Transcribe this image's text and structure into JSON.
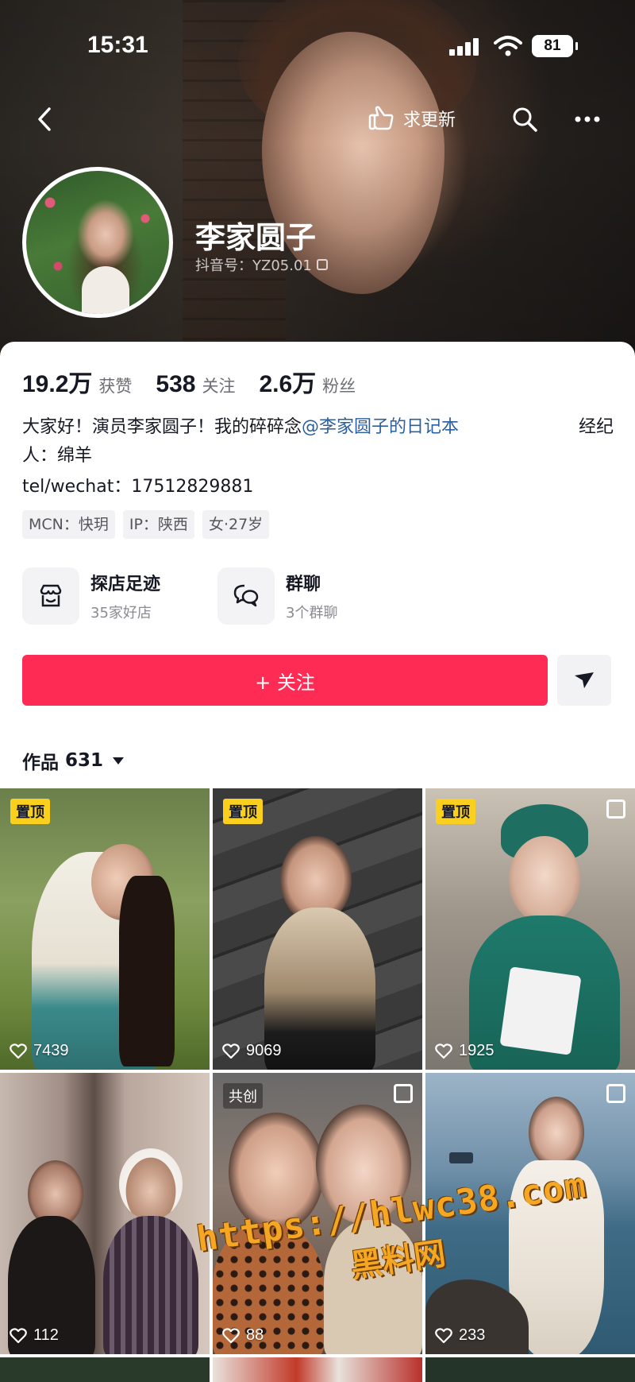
{
  "status_bar": {
    "time": "15:31",
    "battery": "81"
  },
  "nav": {
    "update_label": "求更新"
  },
  "profile": {
    "name": "李家圆子",
    "douyin_id": "抖音号：YZ05.01",
    "stats": [
      {
        "value": "19.2万",
        "label": "获赞"
      },
      {
        "value": "538",
        "label": "关注"
      },
      {
        "value": "2.6万",
        "label": "粉丝"
      }
    ],
    "bio_prefix": "大家好！演员李家圆子！我的碎碎念",
    "bio_mention": "@李家圆子的日记本",
    "bio_agent": "经纪",
    "bio_line2": "人：绵羊",
    "tel": "tel/wechat：17512829881",
    "tags": [
      "MCN：快玥",
      "IP：陕西",
      "女·27岁"
    ]
  },
  "features": [
    {
      "title": "探店足迹",
      "subtitle": "35家好店",
      "icon": "store-icon"
    },
    {
      "title": "群聊",
      "subtitle": "3个群聊",
      "icon": "chat-icon"
    }
  ],
  "follow_label": "+ 关注",
  "works": {
    "label": "作品",
    "count": "631"
  },
  "videos": [
    {
      "likes": "7439",
      "badge": "置顶"
    },
    {
      "likes": "9069",
      "badge": "置顶"
    },
    {
      "likes": "1925",
      "badge": "置顶"
    },
    {
      "likes": "112"
    },
    {
      "likes": "88",
      "badge": "共创"
    },
    {
      "likes": "233"
    }
  ],
  "watermark": {
    "url": "https://hlwc38.com",
    "site": "黑料网"
  }
}
